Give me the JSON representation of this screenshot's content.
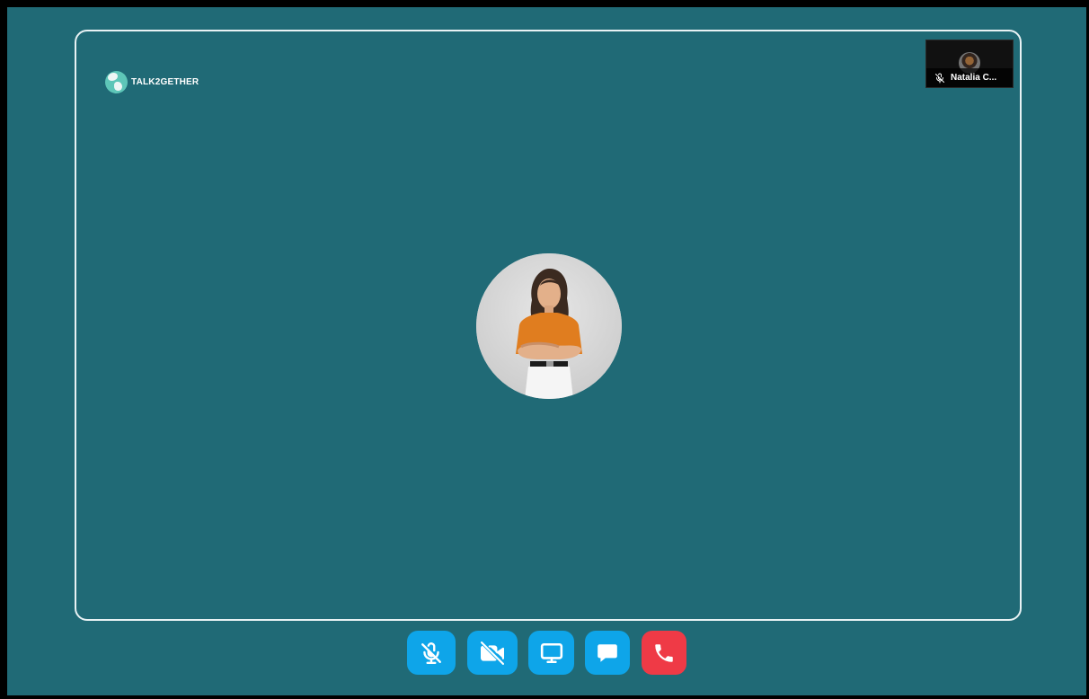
{
  "app": {
    "brand_name": "TALK2GETHER",
    "logo_icon": "globe-logo-icon"
  },
  "self_view": {
    "name": "Natalia C...",
    "mic_icon": "mic-off-icon"
  },
  "main_participant": {
    "avatar_icon": "participant-avatar"
  },
  "controls": {
    "mic": "mic-off-icon",
    "camera": "video-off-icon",
    "screen_share": "monitor-icon",
    "chat": "chat-icon",
    "end_call": "phone-icon"
  },
  "colors": {
    "background": "#206a76",
    "control_blue": "#0ea5e9",
    "end_call_red": "#ef3a46",
    "stage_border": "#e8f2f4"
  }
}
